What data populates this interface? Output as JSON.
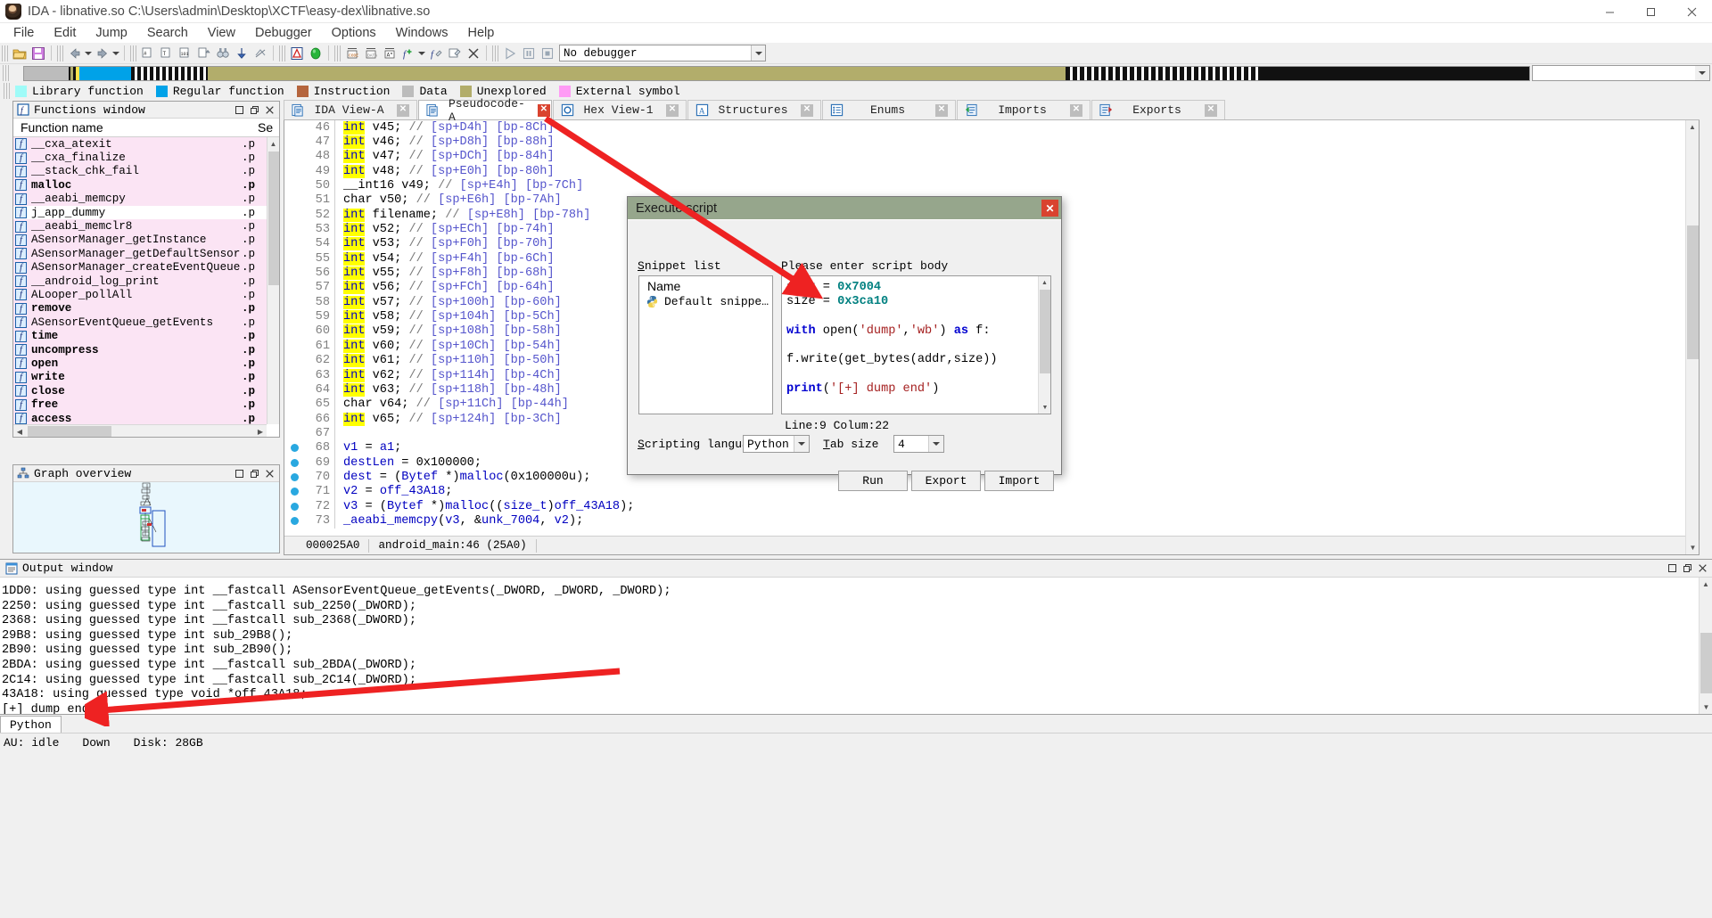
{
  "window": {
    "title": "IDA - libnative.so C:\\Users\\admin\\Desktop\\XCTF\\easy-dex\\libnative.so",
    "minimize": "minimize-icon",
    "maximize": "maximize-icon",
    "close": "close-icon"
  },
  "menu": [
    "File",
    "Edit",
    "Jump",
    "Search",
    "View",
    "Debugger",
    "Options",
    "Windows",
    "Help"
  ],
  "toolbar": {
    "debugger_value": "No debugger",
    "nav_combo_value": ""
  },
  "legend": [
    {
      "label": "Library function",
      "color": "#9ffbf8"
    },
    {
      "label": "Regular function",
      "color": "#00a2e8"
    },
    {
      "label": "Instruction",
      "color": "#b5653e"
    },
    {
      "label": "Data",
      "color": "#bcbcbc"
    },
    {
      "label": "Unexplored",
      "color": "#b2ad6b"
    },
    {
      "label": "External symbol",
      "color": "#ff9bf5"
    }
  ],
  "functions_window": {
    "title": "Functions window",
    "columns": [
      "Function name",
      "Se"
    ],
    "rows": [
      {
        "name": "__cxa_atexit",
        "seg": ".p",
        "bold": false,
        "selected": false
      },
      {
        "name": "__cxa_finalize",
        "seg": ".p",
        "bold": false,
        "selected": false
      },
      {
        "name": "__stack_chk_fail",
        "seg": ".p",
        "bold": false,
        "selected": false
      },
      {
        "name": "malloc",
        "seg": ".p",
        "bold": true,
        "selected": false
      },
      {
        "name": "__aeabi_memcpy",
        "seg": ".p",
        "bold": false,
        "selected": false
      },
      {
        "name": "j_app_dummy",
        "seg": ".p",
        "bold": false,
        "selected": true
      },
      {
        "name": "__aeabi_memclr8",
        "seg": ".p",
        "bold": false,
        "selected": false
      },
      {
        "name": "ASensorManager_getInstance",
        "seg": ".p",
        "bold": false,
        "selected": false
      },
      {
        "name": "ASensorManager_getDefaultSensor",
        "seg": ".p",
        "bold": false,
        "selected": false
      },
      {
        "name": "ASensorManager_createEventQueue",
        "seg": ".p",
        "bold": false,
        "selected": false
      },
      {
        "name": "__android_log_print",
        "seg": ".p",
        "bold": false,
        "selected": false
      },
      {
        "name": "ALooper_pollAll",
        "seg": ".p",
        "bold": false,
        "selected": false
      },
      {
        "name": "remove",
        "seg": ".p",
        "bold": true,
        "selected": false
      },
      {
        "name": "ASensorEventQueue_getEvents",
        "seg": ".p",
        "bold": false,
        "selected": false
      },
      {
        "name": "time",
        "seg": ".p",
        "bold": true,
        "selected": false
      },
      {
        "name": "uncompress",
        "seg": ".p",
        "bold": true,
        "selected": false
      },
      {
        "name": "open",
        "seg": ".p",
        "bold": true,
        "selected": false
      },
      {
        "name": "write",
        "seg": ".p",
        "bold": true,
        "selected": false
      },
      {
        "name": "close",
        "seg": ".p",
        "bold": true,
        "selected": false
      },
      {
        "name": "free",
        "seg": ".p",
        "bold": true,
        "selected": false
      },
      {
        "name": "access",
        "seg": ".p",
        "bold": true,
        "selected": false
      }
    ]
  },
  "graph_overview": {
    "title": "Graph overview"
  },
  "tabs": [
    {
      "label": "IDA View-A",
      "icon": "document-icon",
      "active": false
    },
    {
      "label": "Pseudocode-A",
      "icon": "document-icon",
      "active": true
    },
    {
      "label": "Hex View-1",
      "icon": "hexview-icon",
      "active": false
    },
    {
      "label": "Structures",
      "icon": "structures-icon",
      "active": false
    },
    {
      "label": "Enums",
      "icon": "enums-icon",
      "active": false
    },
    {
      "label": "Imports",
      "icon": "imports-icon",
      "active": false
    },
    {
      "label": "Exports",
      "icon": "exports-icon",
      "active": false
    }
  ],
  "pseudocode": {
    "status_address": "000025A0",
    "status_location": "android_main:46  (25A0)",
    "lines": [
      {
        "n": "46",
        "bp": false,
        "type": "decl",
        "kw": "int",
        "rest": " v45; ",
        "comment": "// ",
        "addr": "[sp+D4h] [bp-8Ch]"
      },
      {
        "n": "47",
        "bp": false,
        "type": "decl",
        "kw": "int",
        "rest": " v46; ",
        "comment": "// ",
        "addr": "[sp+D8h] [bp-88h]"
      },
      {
        "n": "48",
        "bp": false,
        "type": "decl",
        "kw": "int",
        "rest": " v47; ",
        "comment": "// ",
        "addr": "[sp+DCh] [bp-84h]"
      },
      {
        "n": "49",
        "bp": false,
        "type": "decl",
        "kw": "int",
        "rest": " v48; ",
        "comment": "// ",
        "addr": "[sp+E0h] [bp-80h]"
      },
      {
        "n": "50",
        "bp": false,
        "type": "plain_decl",
        "kw": "__int16",
        "rest": " v49; ",
        "comment": "// ",
        "addr": "[sp+E4h] [bp-7Ch]"
      },
      {
        "n": "51",
        "bp": false,
        "type": "plain_decl",
        "kw": "char",
        "rest": " v50; ",
        "comment": "// ",
        "addr": "[sp+E6h] [bp-7Ah]"
      },
      {
        "n": "52",
        "bp": false,
        "type": "decl",
        "kw": "int",
        "rest": " filename; ",
        "comment": "// ",
        "addr": "[sp+E8h] [bp-78h]"
      },
      {
        "n": "53",
        "bp": false,
        "type": "decl",
        "kw": "int",
        "rest": " v52; ",
        "comment": "// ",
        "addr": "[sp+ECh] [bp-74h]"
      },
      {
        "n": "54",
        "bp": false,
        "type": "decl",
        "kw": "int",
        "rest": " v53; ",
        "comment": "// ",
        "addr": "[sp+F0h] [bp-70h]"
      },
      {
        "n": "55",
        "bp": false,
        "type": "decl",
        "kw": "int",
        "rest": " v54; ",
        "comment": "// ",
        "addr": "[sp+F4h] [bp-6Ch]"
      },
      {
        "n": "56",
        "bp": false,
        "type": "decl",
        "kw": "int",
        "rest": " v55; ",
        "comment": "// ",
        "addr": "[sp+F8h] [bp-68h]"
      },
      {
        "n": "57",
        "bp": false,
        "type": "decl",
        "kw": "int",
        "rest": " v56; ",
        "comment": "// ",
        "addr": "[sp+FCh] [bp-64h]"
      },
      {
        "n": "58",
        "bp": false,
        "type": "decl",
        "kw": "int",
        "rest": " v57; ",
        "comment": "// ",
        "addr": "[sp+100h] [bp-60h]"
      },
      {
        "n": "59",
        "bp": false,
        "type": "decl",
        "kw": "int",
        "rest": " v58; ",
        "comment": "// ",
        "addr": "[sp+104h] [bp-5Ch]"
      },
      {
        "n": "60",
        "bp": false,
        "type": "decl",
        "kw": "int",
        "rest": " v59; ",
        "comment": "// ",
        "addr": "[sp+108h] [bp-58h]"
      },
      {
        "n": "61",
        "bp": false,
        "type": "decl",
        "kw": "int",
        "rest": " v60; ",
        "comment": "// ",
        "addr": "[sp+10Ch] [bp-54h]"
      },
      {
        "n": "62",
        "bp": false,
        "type": "decl",
        "kw": "int",
        "rest": " v61; ",
        "comment": "// ",
        "addr": "[sp+110h] [bp-50h]"
      },
      {
        "n": "63",
        "bp": false,
        "type": "decl",
        "kw": "int",
        "rest": " v62; ",
        "comment": "// ",
        "addr": "[sp+114h] [bp-4Ch]"
      },
      {
        "n": "64",
        "bp": false,
        "type": "decl",
        "kw": "int",
        "rest": " v63; ",
        "comment": "// ",
        "addr": "[sp+118h] [bp-48h]"
      },
      {
        "n": "65",
        "bp": false,
        "type": "plain_decl",
        "kw": "char",
        "rest": " v64; ",
        "comment": "// ",
        "addr": "[sp+11Ch] [bp-44h]"
      },
      {
        "n": "66",
        "bp": false,
        "type": "decl",
        "kw": "int",
        "rest": " v65; ",
        "comment": "// ",
        "addr": "[sp+124h] [bp-3Ch]"
      },
      {
        "n": "67",
        "bp": false,
        "type": "blank",
        "text": ""
      },
      {
        "n": "68",
        "bp": true,
        "type": "stmt",
        "text": "v1 = a1;"
      },
      {
        "n": "69",
        "bp": true,
        "type": "stmt",
        "text": "destLen = 0x100000;"
      },
      {
        "n": "70",
        "bp": true,
        "type": "stmt",
        "text": "dest = (Bytef *)malloc(0x100000u);"
      },
      {
        "n": "71",
        "bp": true,
        "type": "stmt",
        "text": "v2 = off_43A18;"
      },
      {
        "n": "72",
        "bp": true,
        "type": "stmt",
        "text": "v3 = (Bytef *)malloc((size_t)off_43A18);"
      },
      {
        "n": "73",
        "bp": true,
        "type": "stmt",
        "text": "_aeabi_memcpy(v3, &unk_7004, v2);"
      }
    ]
  },
  "execute_script": {
    "title": "Execute script",
    "snippet_list_label": "Snippet list",
    "snippet_list_label_mnemonic": "S",
    "snippet_column": "Name",
    "snippets": [
      {
        "name": "Default snippe…",
        "icon": "python-icon"
      }
    ],
    "script_body_label": "Please enter script body",
    "script_lines": [
      [
        {
          "t": "addr = ",
          "c": "plain"
        },
        {
          "t": "0x7004",
          "c": "num"
        }
      ],
      [
        {
          "t": "size = ",
          "c": "plain"
        },
        {
          "t": "0x3ca10",
          "c": "num"
        }
      ],
      [],
      [
        {
          "t": "with",
          "c": "kw"
        },
        {
          "t": " open(",
          "c": "plain"
        },
        {
          "t": "'dump'",
          "c": "str"
        },
        {
          "t": ",",
          "c": "plain"
        },
        {
          "t": "'wb'",
          "c": "str"
        },
        {
          "t": ") ",
          "c": "plain"
        },
        {
          "t": "as",
          "c": "kw"
        },
        {
          "t": " f:",
          "c": "plain"
        }
      ],
      [],
      [
        {
          "t": "f.write(get_bytes(addr,size))",
          "c": "plain"
        }
      ],
      [],
      [
        {
          "t": "print",
          "c": "fn"
        },
        {
          "t": "(",
          "c": "plain"
        },
        {
          "t": "'[+] dump end'",
          "c": "str"
        },
        {
          "t": ")",
          "c": "plain"
        }
      ]
    ],
    "line_column_info": "Line:9  Colum:22",
    "scripting_language_label": "Scripting language",
    "scripting_language_mnemonic": "S",
    "scripting_language_value": "Python",
    "tab_size_label": "Tab size",
    "tab_size_mnemonic": "T",
    "tab_size_value": "4",
    "buttons": [
      "Run",
      "Export",
      "Import"
    ]
  },
  "output_window": {
    "title": "Output window",
    "lines": [
      "1DD0: using guessed type int __fastcall ASensorEventQueue_getEvents(_DWORD, _DWORD, _DWORD);",
      "2250: using guessed type int __fastcall sub_2250(_DWORD);",
      "2368: using guessed type int __fastcall sub_2368(_DWORD);",
      "29B8: using guessed type int sub_29B8();",
      "2B90: using guessed type int sub_2B90();",
      "2BDA: using guessed type int __fastcall sub_2BDA(_DWORD);",
      "2C14: using guessed type int __fastcall sub_2C14(_DWORD);",
      "43A18: using guessed type void *off_43A18;",
      "[+] dump end"
    ]
  },
  "console_tab": {
    "label": "Python"
  },
  "statusbar": {
    "au": "AU: idle",
    "down": "Down",
    "disk": "Disk: 28GB"
  },
  "colors": {
    "dialog_title_bg": "#96a68c",
    "accent_red": "#d9432f",
    "arrow_red": "#ee2222",
    "highlight_yellow": "#ffff00",
    "keyword_blue": "#0000c0",
    "row_pink": "#fbe4f4",
    "nav_unexplored": "#b2ad6b",
    "nav_regular": "#00a2e8"
  }
}
